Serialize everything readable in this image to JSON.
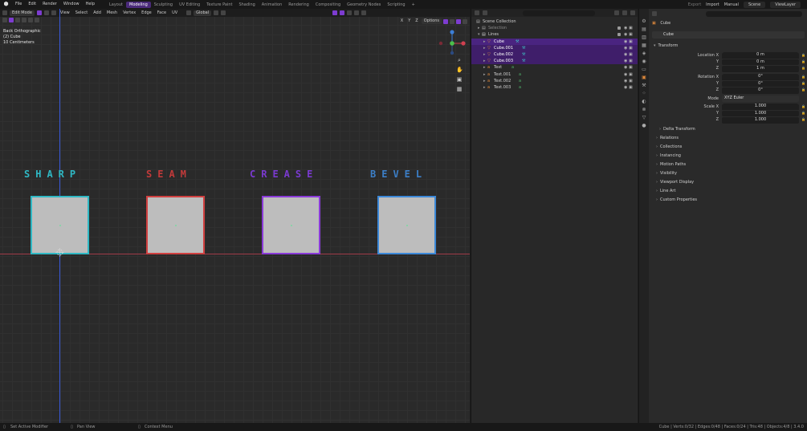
{
  "topbar": {
    "menus": [
      "File",
      "Edit",
      "Render",
      "Window",
      "Help"
    ],
    "workspaces": [
      "Layout",
      "Modeling",
      "Sculpting",
      "UV Editing",
      "Texture Paint",
      "Shading",
      "Animation",
      "Rendering",
      "Compositing",
      "Geometry Nodes",
      "Scripting"
    ],
    "active_workspace": "Modeling",
    "add_tab": "+",
    "export": "Export",
    "import": "Import",
    "manual": "Manual",
    "scene": "Scene",
    "view_layer": "ViewLayer"
  },
  "viewport_header": {
    "mode": "Edit Mode",
    "menus": [
      "View",
      "Select",
      "Add",
      "Mesh",
      "Vertex",
      "Edge",
      "Face",
      "UV"
    ],
    "orientation": "Global",
    "xyz": [
      "X",
      "Y",
      "Z"
    ],
    "options": "Options"
  },
  "viewport_info": {
    "view_name": "Back Orthographic",
    "object": "(2) Cube",
    "scale": "10 Centimeters"
  },
  "scene_labels": [
    {
      "text": "SHARP",
      "color": "#2fb8c4"
    },
    {
      "text": "SEAM",
      "color": "#c23a3a"
    },
    {
      "text": "CREASE",
      "color": "#7a3ad0"
    },
    {
      "text": "BEVEL",
      "color": "#3c7fc8"
    }
  ],
  "cube_edge_colors": [
    "#2fb8c4",
    "#d04040",
    "#8a3ad8",
    "#3c88d8"
  ],
  "outliner": {
    "root": "Scene Collection",
    "rows": [
      {
        "name": "Selection",
        "level": 1,
        "selected": false,
        "dim": true
      },
      {
        "name": "Lines",
        "level": 1,
        "selected": false,
        "dim": false
      },
      {
        "name": "Cube",
        "level": 2,
        "selected": true,
        "active": true
      },
      {
        "name": "Cube.001",
        "level": 2,
        "selected": true
      },
      {
        "name": "Cube.002",
        "level": 2,
        "selected": true
      },
      {
        "name": "Cube.003",
        "level": 2,
        "selected": true
      },
      {
        "name": "Text",
        "level": 2,
        "selected": false
      },
      {
        "name": "Text.001",
        "level": 2,
        "selected": false
      },
      {
        "name": "Text.002",
        "level": 2,
        "selected": false
      },
      {
        "name": "Text.003",
        "level": 2,
        "selected": false
      }
    ]
  },
  "properties": {
    "object_name_header": "Cube",
    "object_name_field": "Cube",
    "transform_title": "Transform",
    "location": {
      "label": "Location X",
      "y_label": "Y",
      "z_label": "Z",
      "x": "0 m",
      "y": "0 m",
      "z": "1 m"
    },
    "rotation": {
      "label": "Rotation X",
      "y_label": "Y",
      "z_label": "Z",
      "x": "0°",
      "y": "0°",
      "z": "0°"
    },
    "mode": {
      "label": "Mode",
      "value": "XYZ Euler"
    },
    "scale": {
      "label": "Scale X",
      "y_label": "Y",
      "z_label": "Z",
      "x": "1.000",
      "y": "1.000",
      "z": "1.000"
    },
    "delta": "Delta Transform",
    "sections": [
      "Relations",
      "Collections",
      "Instancing",
      "Motion Paths",
      "Visibility",
      "Viewport Display",
      "Line Art",
      "Custom Properties"
    ]
  },
  "statusbar": {
    "left": "Set Active Modifier",
    "pan": "Pan View",
    "context": "Context Menu",
    "stats": "Cube | Verts:0/32 | Edges:0/48 | Faces:0/24 | Tris:48 | Objects:4/8 | 3.4.0"
  }
}
